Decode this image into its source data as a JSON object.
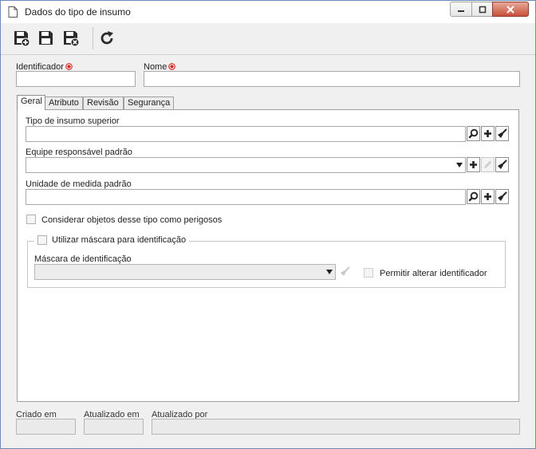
{
  "window": {
    "title": "Dados do tipo de insumo"
  },
  "toolbar": {
    "save_new_icon": "save-and-new-icon",
    "save_icon": "save-icon",
    "save_close_icon": "save-and-close-icon",
    "refresh_icon": "refresh-icon"
  },
  "header": {
    "identifier_label": "Identificador",
    "identifier_value": "",
    "name_label": "Nome",
    "name_value": ""
  },
  "tabs": [
    {
      "label": "Geral",
      "active": true
    },
    {
      "label": "Atributo",
      "active": false
    },
    {
      "label": "Revisão",
      "active": false
    },
    {
      "label": "Segurança",
      "active": false
    }
  ],
  "general": {
    "parent_type_label": "Tipo de insumo superior",
    "parent_type_value": "",
    "team_label": "Equipe responsável padrão",
    "team_value": "",
    "unit_label": "Unidade de medida padrão",
    "unit_value": "",
    "dangerous_label": "Considerar objetos desse tipo como perigosos",
    "mask_group_label": "Utilizar máscara para identificação",
    "mask_label": "Máscara de identificação",
    "mask_value": "",
    "allow_change_label": "Permitir alterar identificador"
  },
  "footer": {
    "created_label": "Criado em",
    "created_value": "",
    "updated_label": "Atualizado em",
    "updated_value": "",
    "updated_by_label": "Atualizado por",
    "updated_by_value": ""
  },
  "colors": {
    "required_marker": "#d9261c",
    "window_border": "#6b8cb6",
    "close_button": "#c7503c"
  }
}
